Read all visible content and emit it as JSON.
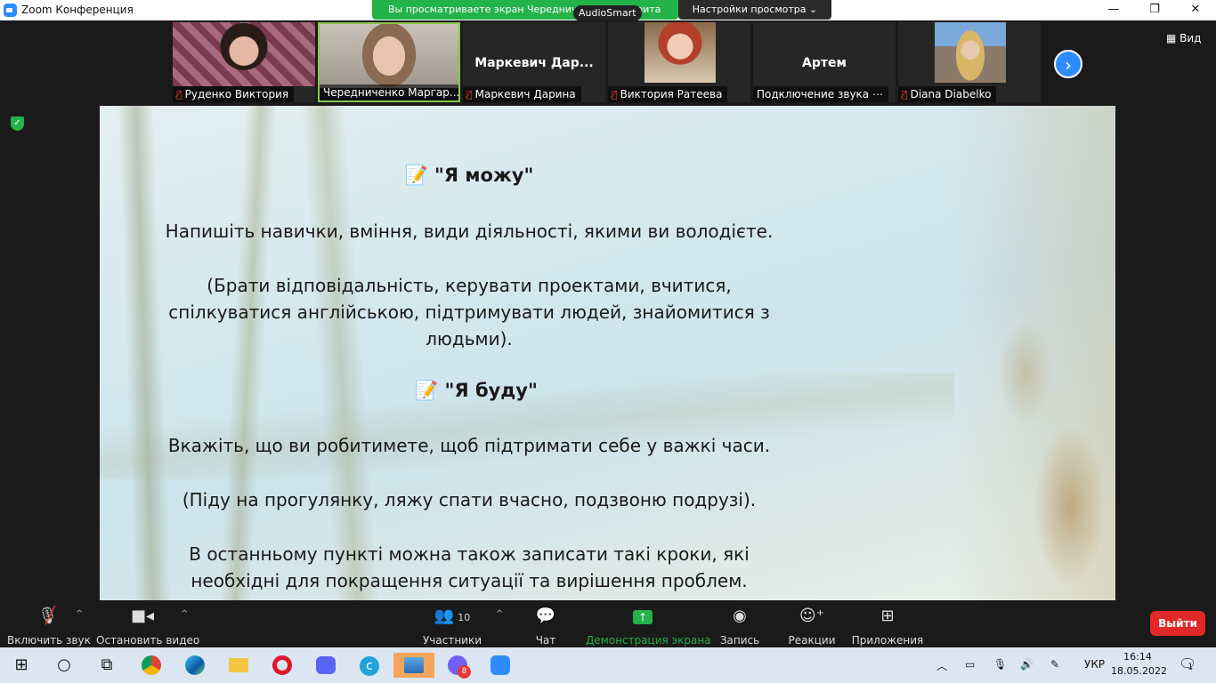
{
  "window": {
    "title": "Zoom Конференция",
    "minimize": "—",
    "maximize": "❐",
    "close": "✕"
  },
  "share_banner": {
    "text": "Вы просматриваете экран Чередниченко Маргарита",
    "audiosmart": "AudioSmart",
    "view_settings": "Настройки просмотра ⌄"
  },
  "participants": [
    {
      "name": "Руденко  Виктория",
      "muted": true,
      "video": true,
      "active": false
    },
    {
      "name": "Чередниченко Маргар...",
      "muted": false,
      "video": true,
      "active": true
    },
    {
      "name": "Маркевич Дарина",
      "big_name": "Маркевич  Дар...",
      "muted": true,
      "video": false,
      "active": false
    },
    {
      "name": "Виктория Ратеева",
      "muted": true,
      "video": true,
      "active": false
    },
    {
      "name": "Подключение звука ⋯",
      "big_name": "Артем",
      "muted": false,
      "video": false,
      "active": false
    },
    {
      "name": "Diana Diabelko",
      "muted": true,
      "video": true,
      "active": false
    }
  ],
  "view_button": "▦ Вид",
  "slide": {
    "heading1": "📝 \"Я можу\"",
    "para1": "Напишіть навички, вміння, види діяльності, якими ви володієте.",
    "para2": "(Брати відповідальність, керувати проектами, вчитися, спілкуватися англійською, підтримувати людей, знайомитися з людьми).",
    "heading2": "📝 \"Я буду\"",
    "para3": "Вкажіть, що ви робитимете, щоб підтримати себе у важкі часи.",
    "para4": "(Піду на прогулянку, ляжу спати вчасно, подзвоню подрузі).",
    "para5": "В останньому пункті можна також записати такі кроки, які необхідні для покращення ситуації та вирішення проблем."
  },
  "toolbar": {
    "unmute": "Включить звук",
    "stop_video": "Остановить видео",
    "participants": "Участники",
    "participants_count": "10",
    "chat": "Чат",
    "share": "Демонстрация экрана",
    "record": "Запись",
    "reactions": "Реакции",
    "apps": "Приложения",
    "leave": "Выйти"
  },
  "taskbar": {
    "lang": "УКР",
    "time": "16:14",
    "date": "18.05.2022",
    "viber_badge": "8",
    "notif_count": "1"
  },
  "colors": {
    "accent": "#2d8cff",
    "share_green": "#24b24a",
    "leave_red": "#e02828"
  }
}
